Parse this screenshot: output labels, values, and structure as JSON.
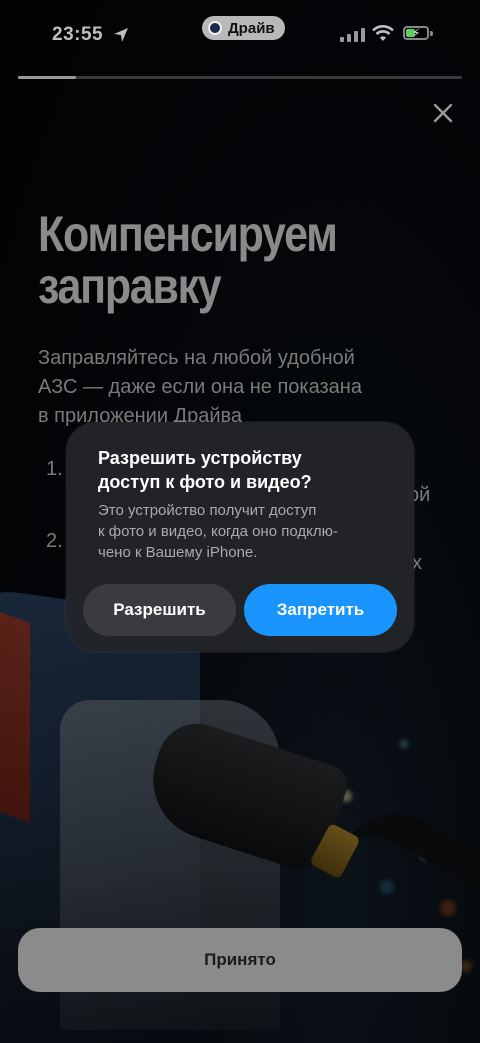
{
  "status_bar": {
    "time": "23:55",
    "app_pill": "Драйв",
    "icons": [
      "location-icon",
      "signal-icon",
      "wifi-icon",
      "battery-icon"
    ]
  },
  "progress": {
    "value_percent": 13
  },
  "promo": {
    "title_line1": "Компенсируем",
    "title_line2": "заправку",
    "desc_line1": "Заправляйтесь на любой удобной",
    "desc_line2": "АЗС — даже если она не показана",
    "desc_line3": "в приложении Драйва",
    "list": [
      {
        "num": "1.",
        "tail": "ой"
      },
      {
        "num": "2.",
        "tail": "х"
      }
    ]
  },
  "dialog": {
    "title_line1": "Разрешить устройству",
    "title_line2": "доступ к фото и видео?",
    "text_line1": "Это устройство получит доступ",
    "text_line2": "к фото и видео, когда оно подклю-",
    "text_line3": "чено к Вашему iPhone.",
    "allow_label": "Разрешить",
    "deny_label": "Запретить"
  },
  "footer": {
    "accept_label": "Принято"
  },
  "colors": {
    "deny_button": "#1a95ff",
    "battery": "#5bd25f"
  }
}
